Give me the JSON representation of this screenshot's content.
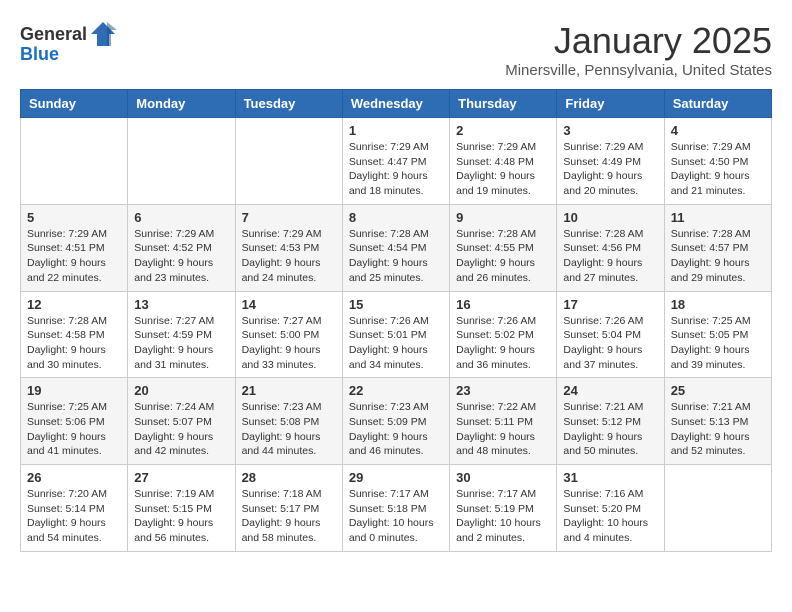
{
  "header": {
    "logo_general": "General",
    "logo_blue": "Blue",
    "title": "January 2025",
    "subtitle": "Minersville, Pennsylvania, United States"
  },
  "columns": [
    "Sunday",
    "Monday",
    "Tuesday",
    "Wednesday",
    "Thursday",
    "Friday",
    "Saturday"
  ],
  "weeks": [
    [
      {
        "day": "",
        "info": ""
      },
      {
        "day": "",
        "info": ""
      },
      {
        "day": "",
        "info": ""
      },
      {
        "day": "1",
        "info": "Sunrise: 7:29 AM\nSunset: 4:47 PM\nDaylight: 9 hours\nand 18 minutes."
      },
      {
        "day": "2",
        "info": "Sunrise: 7:29 AM\nSunset: 4:48 PM\nDaylight: 9 hours\nand 19 minutes."
      },
      {
        "day": "3",
        "info": "Sunrise: 7:29 AM\nSunset: 4:49 PM\nDaylight: 9 hours\nand 20 minutes."
      },
      {
        "day": "4",
        "info": "Sunrise: 7:29 AM\nSunset: 4:50 PM\nDaylight: 9 hours\nand 21 minutes."
      }
    ],
    [
      {
        "day": "5",
        "info": "Sunrise: 7:29 AM\nSunset: 4:51 PM\nDaylight: 9 hours\nand 22 minutes."
      },
      {
        "day": "6",
        "info": "Sunrise: 7:29 AM\nSunset: 4:52 PM\nDaylight: 9 hours\nand 23 minutes."
      },
      {
        "day": "7",
        "info": "Sunrise: 7:29 AM\nSunset: 4:53 PM\nDaylight: 9 hours\nand 24 minutes."
      },
      {
        "day": "8",
        "info": "Sunrise: 7:28 AM\nSunset: 4:54 PM\nDaylight: 9 hours\nand 25 minutes."
      },
      {
        "day": "9",
        "info": "Sunrise: 7:28 AM\nSunset: 4:55 PM\nDaylight: 9 hours\nand 26 minutes."
      },
      {
        "day": "10",
        "info": "Sunrise: 7:28 AM\nSunset: 4:56 PM\nDaylight: 9 hours\nand 27 minutes."
      },
      {
        "day": "11",
        "info": "Sunrise: 7:28 AM\nSunset: 4:57 PM\nDaylight: 9 hours\nand 29 minutes."
      }
    ],
    [
      {
        "day": "12",
        "info": "Sunrise: 7:28 AM\nSunset: 4:58 PM\nDaylight: 9 hours\nand 30 minutes."
      },
      {
        "day": "13",
        "info": "Sunrise: 7:27 AM\nSunset: 4:59 PM\nDaylight: 9 hours\nand 31 minutes."
      },
      {
        "day": "14",
        "info": "Sunrise: 7:27 AM\nSunset: 5:00 PM\nDaylight: 9 hours\nand 33 minutes."
      },
      {
        "day": "15",
        "info": "Sunrise: 7:26 AM\nSunset: 5:01 PM\nDaylight: 9 hours\nand 34 minutes."
      },
      {
        "day": "16",
        "info": "Sunrise: 7:26 AM\nSunset: 5:02 PM\nDaylight: 9 hours\nand 36 minutes."
      },
      {
        "day": "17",
        "info": "Sunrise: 7:26 AM\nSunset: 5:04 PM\nDaylight: 9 hours\nand 37 minutes."
      },
      {
        "day": "18",
        "info": "Sunrise: 7:25 AM\nSunset: 5:05 PM\nDaylight: 9 hours\nand 39 minutes."
      }
    ],
    [
      {
        "day": "19",
        "info": "Sunrise: 7:25 AM\nSunset: 5:06 PM\nDaylight: 9 hours\nand 41 minutes."
      },
      {
        "day": "20",
        "info": "Sunrise: 7:24 AM\nSunset: 5:07 PM\nDaylight: 9 hours\nand 42 minutes."
      },
      {
        "day": "21",
        "info": "Sunrise: 7:23 AM\nSunset: 5:08 PM\nDaylight: 9 hours\nand 44 minutes."
      },
      {
        "day": "22",
        "info": "Sunrise: 7:23 AM\nSunset: 5:09 PM\nDaylight: 9 hours\nand 46 minutes."
      },
      {
        "day": "23",
        "info": "Sunrise: 7:22 AM\nSunset: 5:11 PM\nDaylight: 9 hours\nand 48 minutes."
      },
      {
        "day": "24",
        "info": "Sunrise: 7:21 AM\nSunset: 5:12 PM\nDaylight: 9 hours\nand 50 minutes."
      },
      {
        "day": "25",
        "info": "Sunrise: 7:21 AM\nSunset: 5:13 PM\nDaylight: 9 hours\nand 52 minutes."
      }
    ],
    [
      {
        "day": "26",
        "info": "Sunrise: 7:20 AM\nSunset: 5:14 PM\nDaylight: 9 hours\nand 54 minutes."
      },
      {
        "day": "27",
        "info": "Sunrise: 7:19 AM\nSunset: 5:15 PM\nDaylight: 9 hours\nand 56 minutes."
      },
      {
        "day": "28",
        "info": "Sunrise: 7:18 AM\nSunset: 5:17 PM\nDaylight: 9 hours\nand 58 minutes."
      },
      {
        "day": "29",
        "info": "Sunrise: 7:17 AM\nSunset: 5:18 PM\nDaylight: 10 hours\nand 0 minutes."
      },
      {
        "day": "30",
        "info": "Sunrise: 7:17 AM\nSunset: 5:19 PM\nDaylight: 10 hours\nand 2 minutes."
      },
      {
        "day": "31",
        "info": "Sunrise: 7:16 AM\nSunset: 5:20 PM\nDaylight: 10 hours\nand 4 minutes."
      },
      {
        "day": "",
        "info": ""
      }
    ]
  ]
}
